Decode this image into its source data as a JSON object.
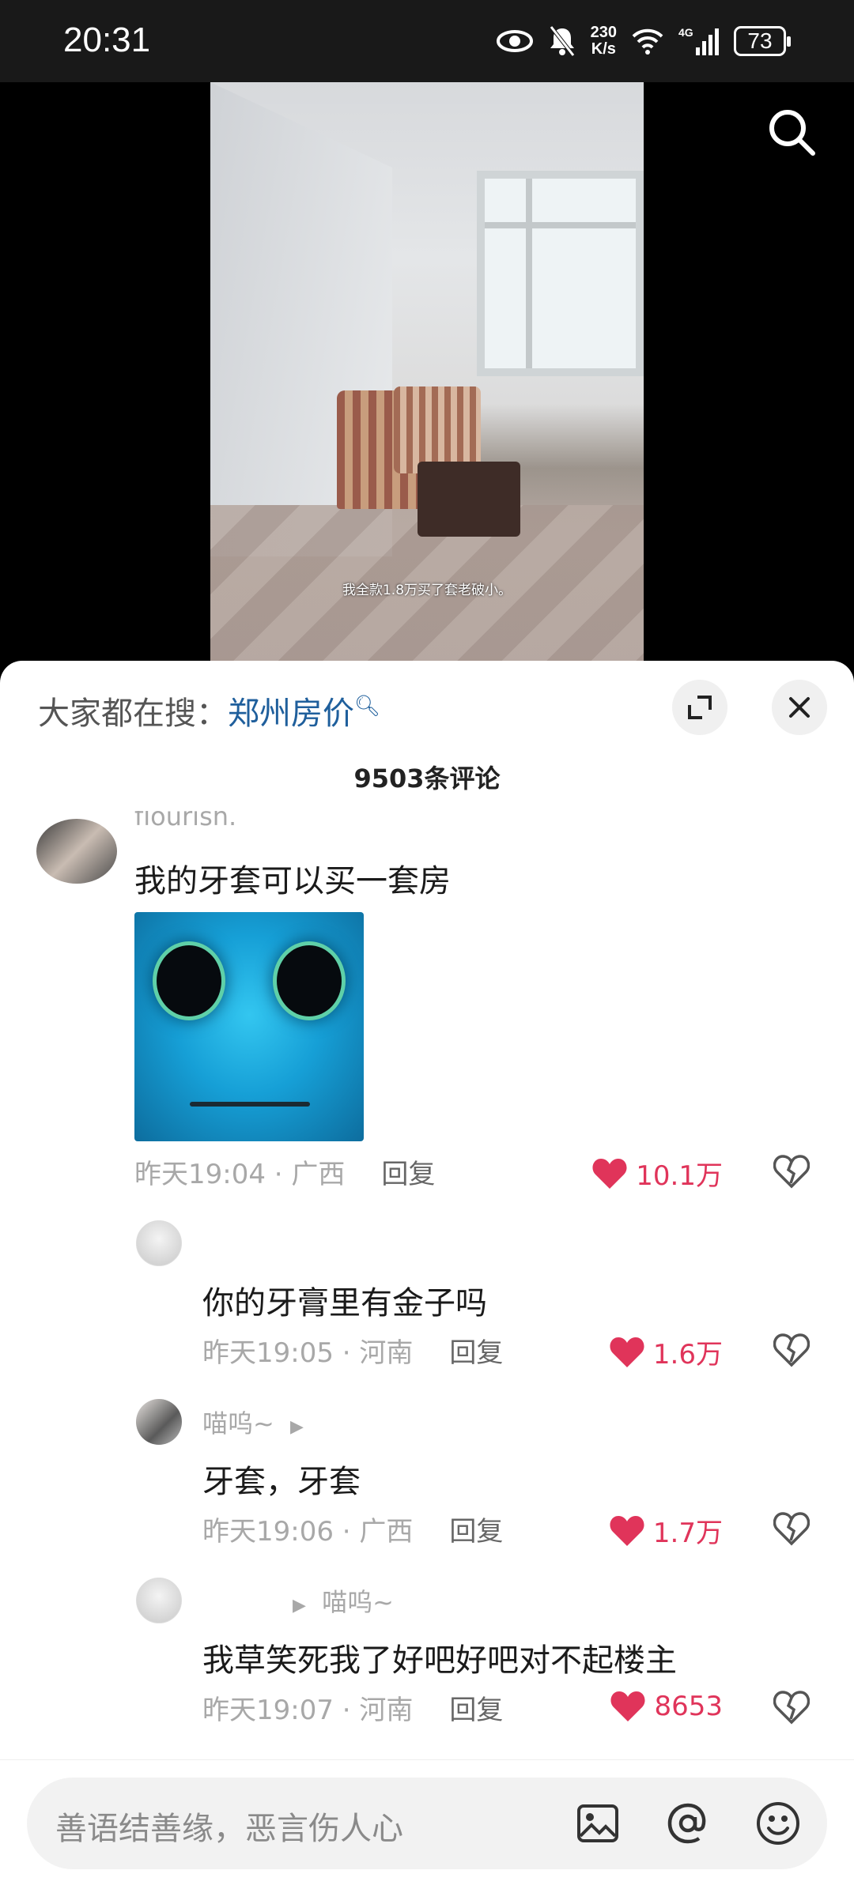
{
  "status_bar": {
    "time": "20:31",
    "net_speed_top": "230",
    "net_speed_bottom": "K/s",
    "network": "4G",
    "battery": "73"
  },
  "video": {
    "caption": "我全款1.8万买了套老破小。"
  },
  "sheet": {
    "hot_search_prefix": "大家都在搜：",
    "hot_search_term": "郑州房价",
    "comment_count": "9503条评论"
  },
  "comments": [
    {
      "username": "flourish.",
      "text": "我的牙套可以买一套房",
      "time": "昨天19:04",
      "location": "广西",
      "reply_label": "回复",
      "likes": "10.1万"
    },
    {
      "username": "",
      "text": "你的牙膏里有金子吗",
      "time": "昨天19:05",
      "location": "河南",
      "reply_label": "回复",
      "likes": "1.6万"
    },
    {
      "username": "喵呜~",
      "text": "牙套，牙套",
      "time": "昨天19:06",
      "location": "广西",
      "reply_label": "回复",
      "likes": "1.7万"
    },
    {
      "username": "喵呜~",
      "text": "我草笑死我了好吧好吧对不起楼主",
      "time": "昨天19:07",
      "location": "河南",
      "reply_label": "回复",
      "likes": "8653"
    }
  ],
  "input": {
    "placeholder": "善语结善缘，恶言伤人心"
  },
  "colors": {
    "like_red": "#e0345a",
    "link_blue": "#1f5f9c"
  }
}
